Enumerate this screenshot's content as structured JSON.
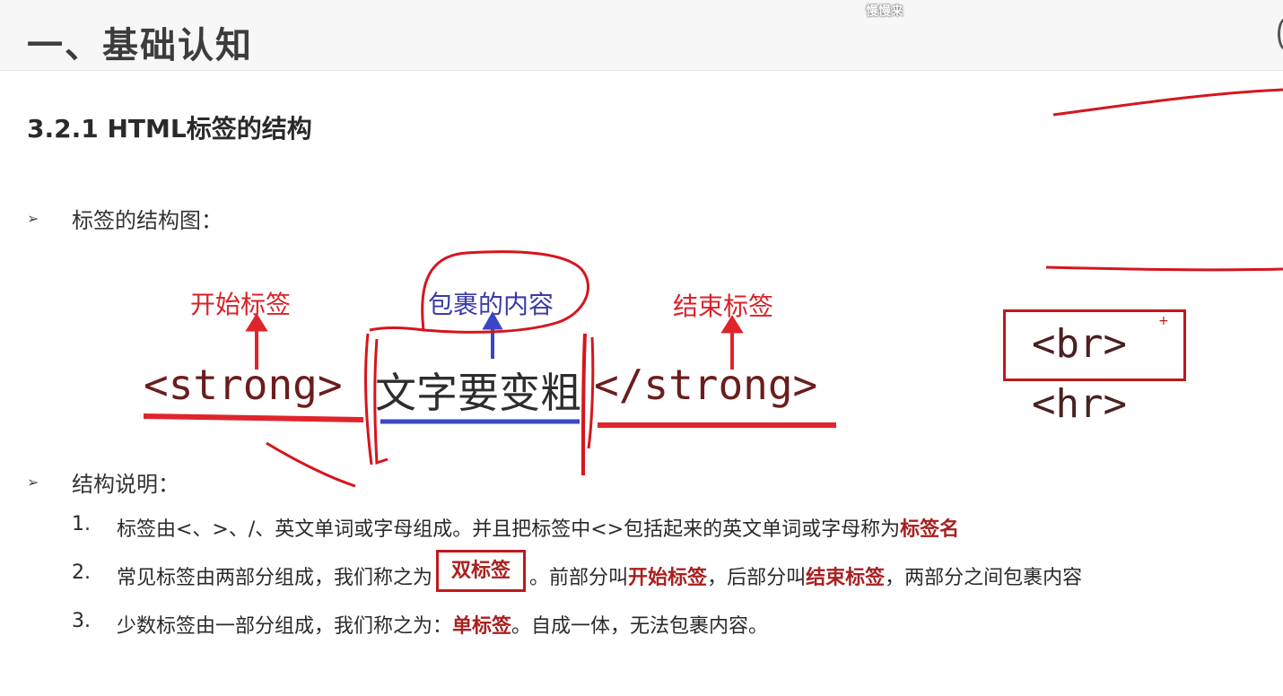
{
  "header": {
    "chapter_title": "一、基础认知",
    "watermark": "慢慢来"
  },
  "section": {
    "title": "3.2.1 HTML标签的结构"
  },
  "bullets": [
    {
      "arrow": "➢",
      "text": "标签的结构图："
    },
    {
      "arrow": "➢",
      "text": "结构说明："
    }
  ],
  "diagram": {
    "open_tag": "<strong>",
    "content": "文字要变粗",
    "close_tag": "</strong>",
    "open_label": "开始标签",
    "content_label": "包裹的内容",
    "close_label": "结束标签",
    "single_tags": [
      "<br>",
      "<hr>"
    ],
    "plus": "+"
  },
  "list": [
    {
      "num": "1.",
      "parts": [
        "标签由<、>、/、英文单词或字母组成。并且把标签中<>包括起来的英文单词或字母称为",
        "标签名",
        ""
      ]
    },
    {
      "num": "2.",
      "pre": "常见标签由两部分组成，我们称之为",
      "boxed": "双标签",
      "mid1": "。前部分叫",
      "hl1": "开始标签",
      "mid2": "，后部分叫",
      "hl2": "结束标签",
      "post": "，两部分之间包裹内容"
    },
    {
      "num": "3.",
      "pre": "少数标签由一部分组成，我们称之为：",
      "hl": "单标签",
      "post": "。自成一体，无法包裹内容。"
    }
  ],
  "colors": {
    "red": "#d9222a",
    "blue": "#3a3aa8",
    "dark_red": "#a92020"
  }
}
